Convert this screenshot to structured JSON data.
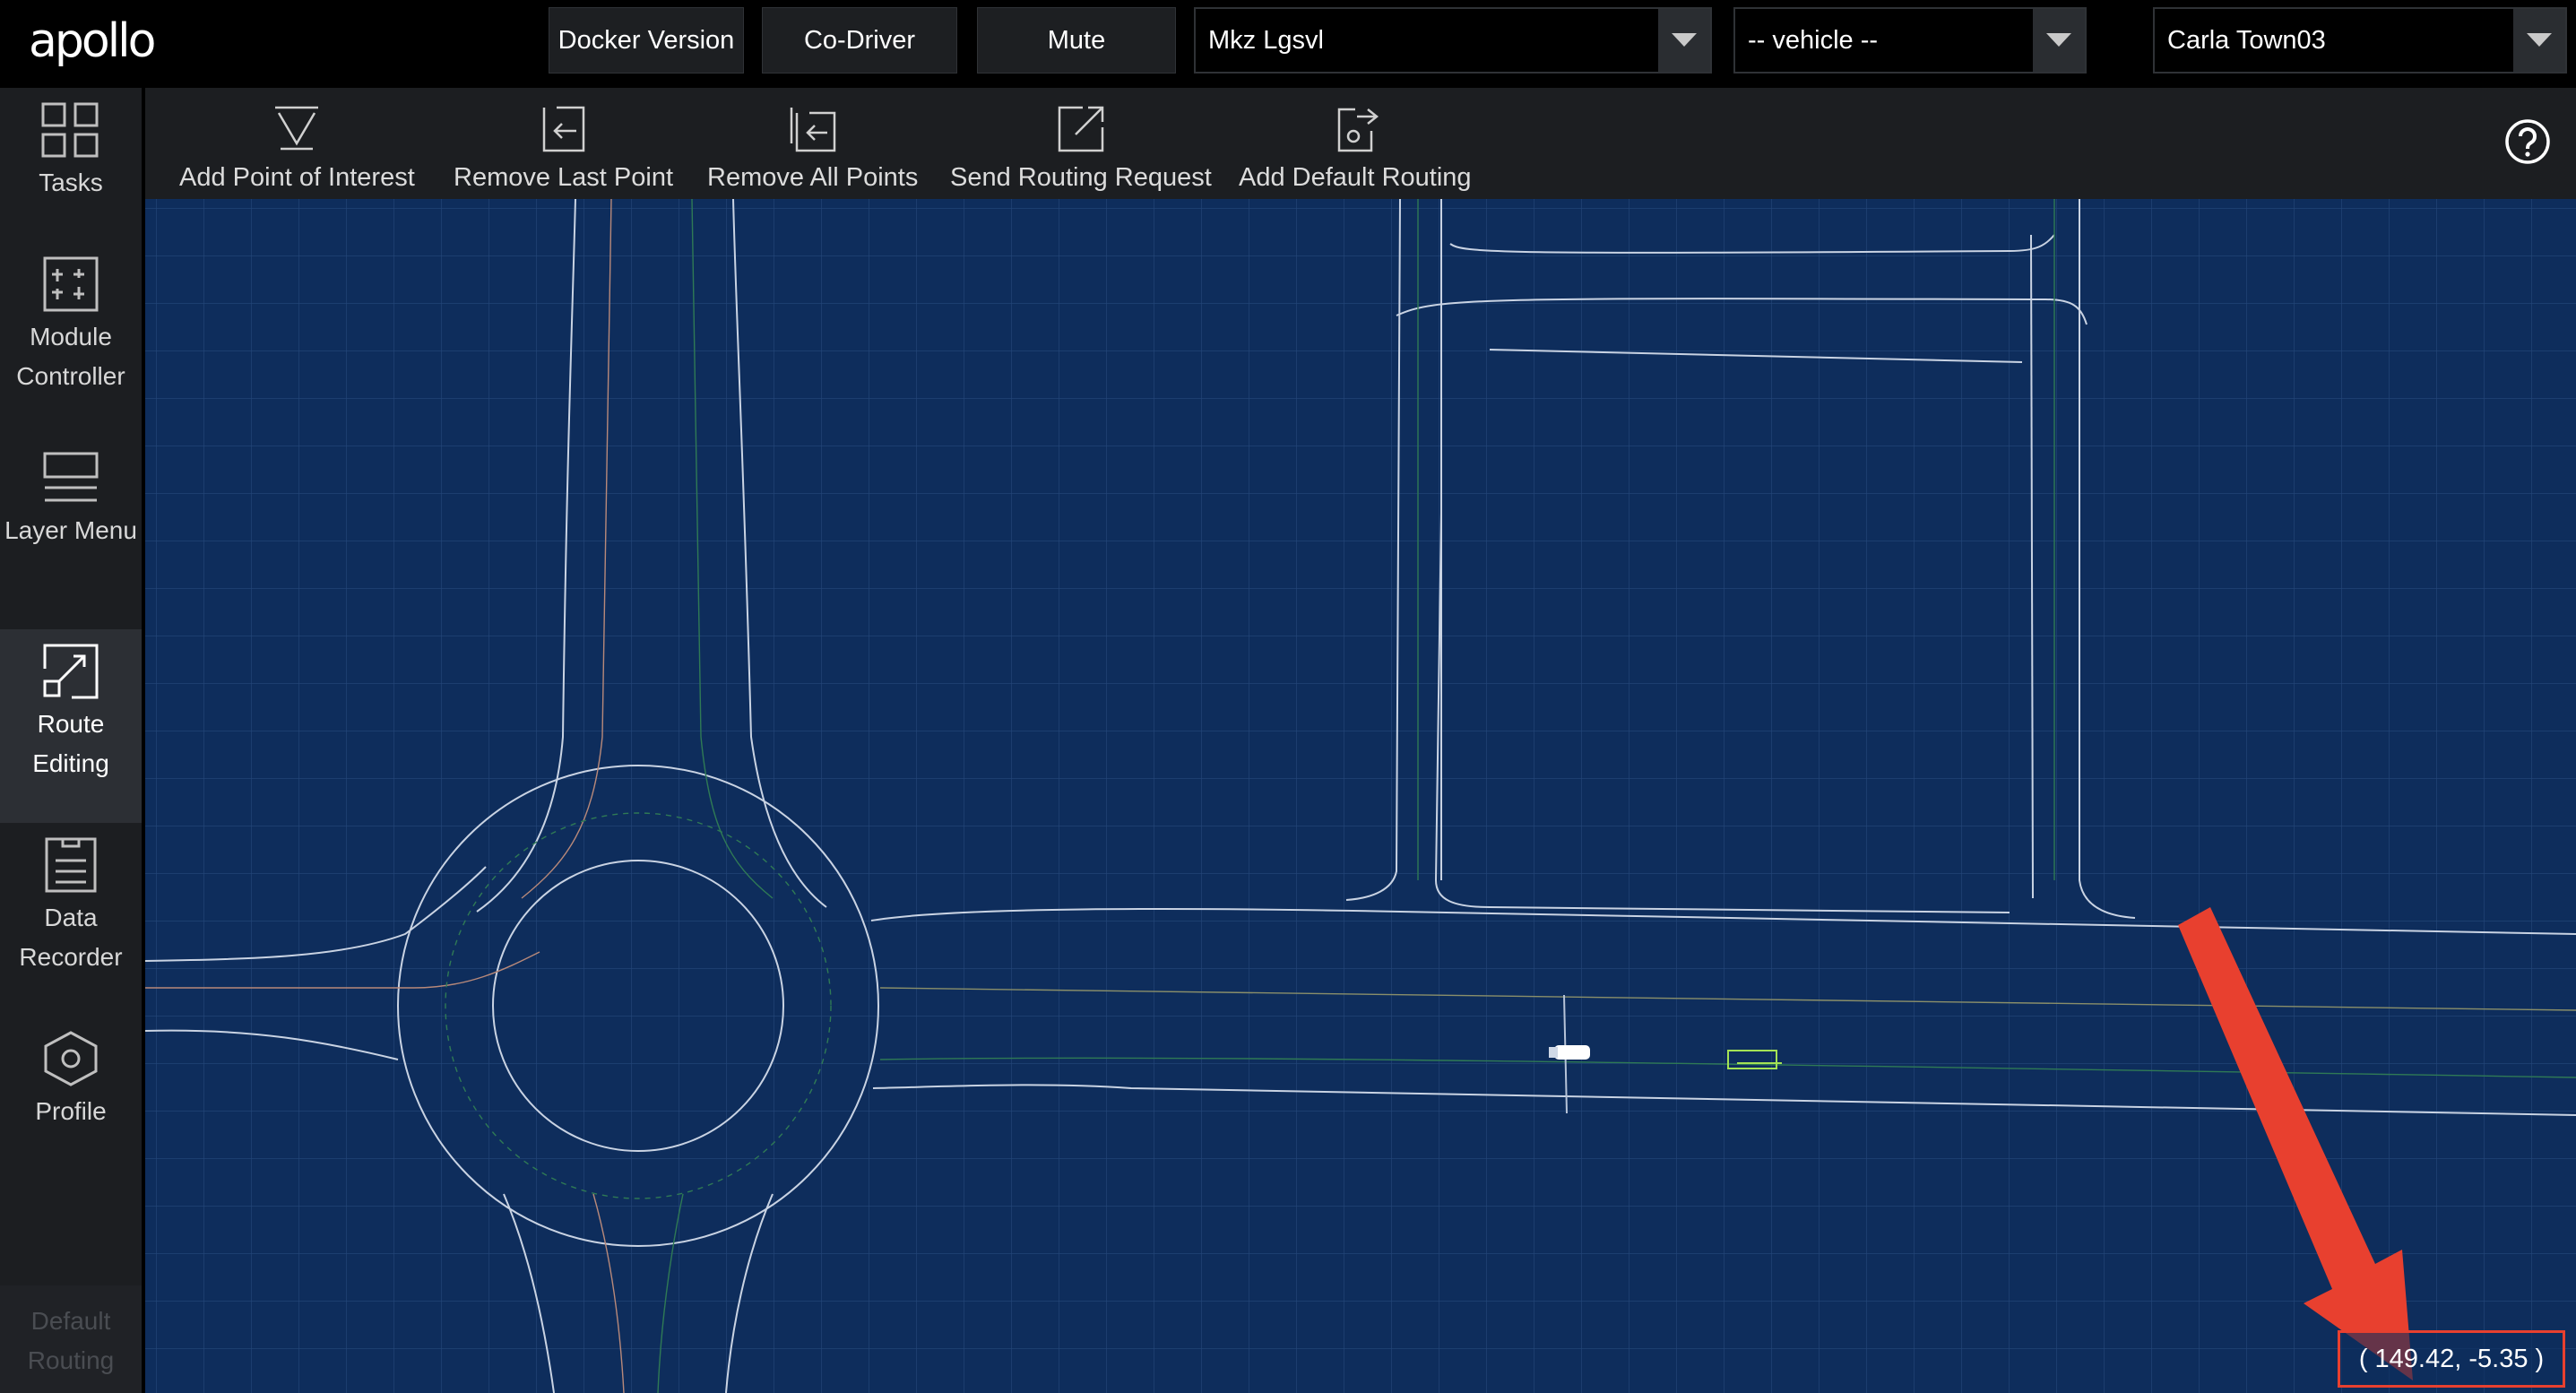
{
  "app": {
    "logo_text": "apollo"
  },
  "header": {
    "buttons": [
      {
        "label": "Docker Version"
      },
      {
        "label": "Co-Driver"
      },
      {
        "label": "Mute"
      }
    ],
    "selects": [
      {
        "value": "Mkz Lgsvl"
      },
      {
        "value": "-- vehicle --"
      },
      {
        "value": "Carla Town03"
      }
    ]
  },
  "sidebar": {
    "items": [
      {
        "label": "Tasks",
        "icon": "tasks-icon"
      },
      {
        "label": "Module Controller",
        "icon": "module-controller-icon"
      },
      {
        "label": "Layer Menu",
        "icon": "layer-menu-icon"
      },
      {
        "label": "Route Editing",
        "icon": "route-editing-icon",
        "active": true
      },
      {
        "label": "Data Recorder",
        "icon": "data-recorder-icon"
      },
      {
        "label": "Profile",
        "icon": "profile-icon"
      },
      {
        "label": "Default Routing",
        "disabled": true
      }
    ]
  },
  "toolbar": {
    "tools": [
      {
        "label": "Add Point of Interest",
        "icon": "add-point-of-interest-icon"
      },
      {
        "label": "Remove Last Point",
        "icon": "remove-last-point-icon"
      },
      {
        "label": "Remove All Points",
        "icon": "remove-all-points-icon"
      },
      {
        "label": "Send Routing Request",
        "icon": "send-routing-request-icon"
      },
      {
        "label": "Add Default Routing",
        "icon": "add-default-routing-icon"
      }
    ],
    "help_icon": "help-icon"
  },
  "map": {
    "coordinates": "( 149.42, -5.35 )",
    "colors": {
      "background": "#0e2d5c",
      "grid": "#24477a",
      "lane": "#c9d3e3",
      "annotation": "#e8402f"
    }
  }
}
